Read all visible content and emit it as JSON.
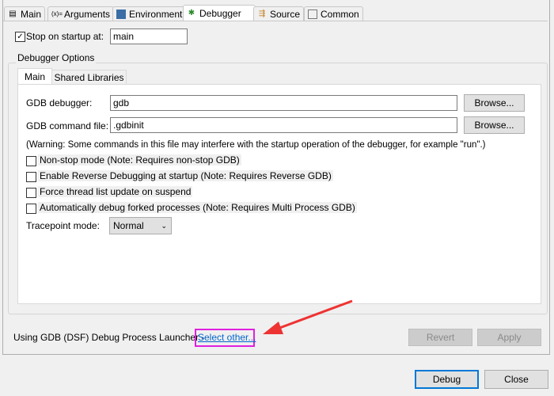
{
  "tabs": [
    {
      "label": "Main",
      "icon": "file-icon"
    },
    {
      "label": "Arguments",
      "icon": "arguments-icon"
    },
    {
      "label": "Environment",
      "icon": "environment-icon"
    },
    {
      "label": "Debugger",
      "icon": "bug-icon",
      "active": true
    },
    {
      "label": "Source",
      "icon": "source-icon"
    },
    {
      "label": "Common",
      "icon": "common-icon"
    }
  ],
  "stop_on_startup": {
    "label": "Stop on startup at:",
    "checked": true,
    "value": "main"
  },
  "debugger_options": {
    "title": "Debugger Options",
    "tabs": [
      {
        "label": "Main",
        "active": true
      },
      {
        "label": "Shared Libraries"
      }
    ],
    "gdb_debugger": {
      "label": "GDB debugger:",
      "value": "gdb",
      "browse": "Browse..."
    },
    "gdb_command_file": {
      "label": "GDB command file:",
      "value": ".gdbinit",
      "browse": "Browse..."
    },
    "warning": "(Warning: Some commands in this file may interfere with the startup operation of the debugger, for example \"run\".)",
    "options": [
      {
        "label": "Non-stop mode (Note: Requires non-stop GDB)",
        "checked": false
      },
      {
        "label": "Enable Reverse Debugging at startup (Note: Requires Reverse GDB)",
        "checked": false
      },
      {
        "label": "Force thread list update on suspend",
        "checked": false
      },
      {
        "label": "Automatically debug forked processes (Note: Requires Multi Process GDB)",
        "checked": false
      }
    ],
    "tracepoint": {
      "label": "Tracepoint mode:",
      "value": "Normal"
    }
  },
  "launcher": {
    "text": "Using GDB (DSF) Debug Process Launcher -",
    "link": "Select other..."
  },
  "buttons": {
    "revert": "Revert",
    "apply": "Apply",
    "debug": "Debug",
    "close": "Close"
  },
  "colors": {
    "highlight_box": "#e020e0",
    "arrow": "#ee3333",
    "link": "#0066cc",
    "focus": "#0078d7"
  }
}
